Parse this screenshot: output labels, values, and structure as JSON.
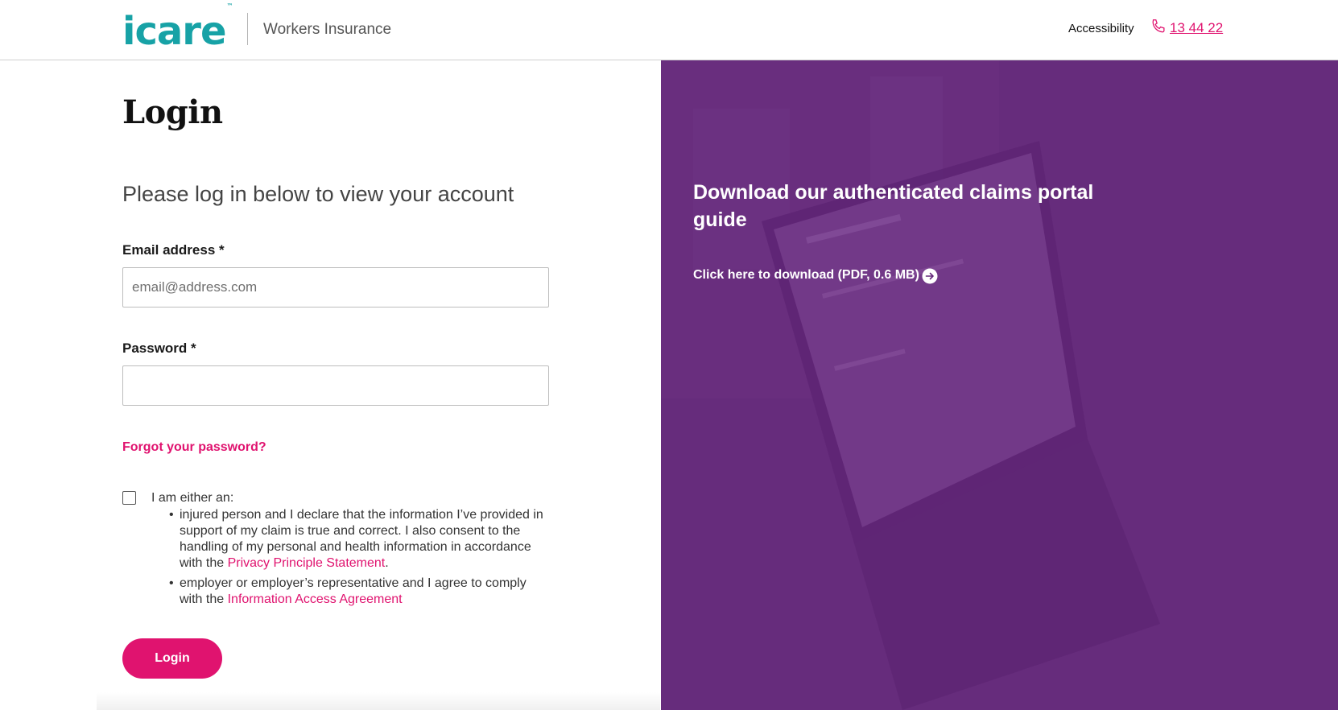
{
  "header": {
    "logo_text": "icare",
    "logo_tm": "™",
    "brand_subtitle": "Workers Insurance",
    "accessibility_label": "Accessibility",
    "phone_number": "13 44 22"
  },
  "login": {
    "title": "Login",
    "intro": "Please log in below to view your account",
    "email_label": "Email address *",
    "email_placeholder": "email@address.com",
    "email_value": "",
    "password_label": "Password *",
    "password_value": "",
    "forgot_label": "Forgot your password?",
    "consent": {
      "checked": false,
      "intro": "I am either an:",
      "item1_text": "injured person and I declare that the information I’ve provided in support of my claim is true and correct. I also consent to the handling of my personal and health information in accordance with the ",
      "item1_link": "Privacy Principle Statement",
      "item1_suffix": ".",
      "item2_text": "employer or employer’s representative and I agree to comply with the ",
      "item2_link": "Information Access Agreement"
    },
    "button_label": "Login"
  },
  "promo": {
    "title": "Download our authenticated claims portal guide",
    "link_label": "Click here to download (PDF, 0.6 MB)"
  },
  "colors": {
    "brand_teal": "#17a2a6",
    "accent_pink": "#e0136f",
    "promo_purple": "#64297a"
  },
  "icons": {
    "phone": "phone-icon",
    "arrow": "arrow-right-circle-icon"
  }
}
